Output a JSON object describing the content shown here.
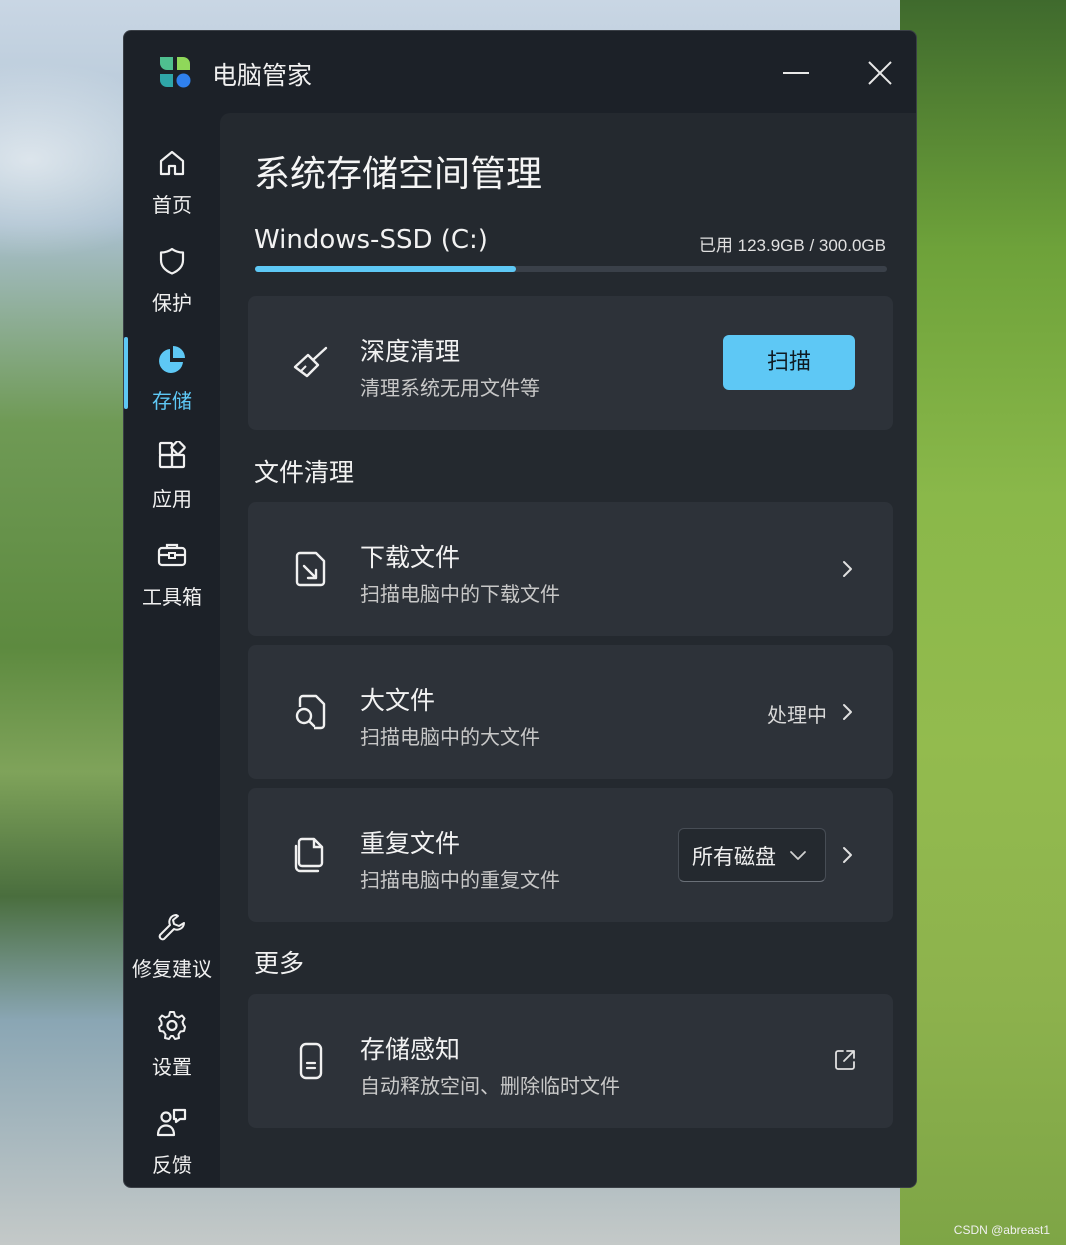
{
  "app": {
    "title": "电脑管家"
  },
  "sidebar": {
    "items": [
      {
        "label": "首页",
        "icon": "home-icon"
      },
      {
        "label": "保护",
        "icon": "shield-icon"
      },
      {
        "label": "存储",
        "icon": "pie-chart-icon",
        "active": true
      },
      {
        "label": "应用",
        "icon": "apps-icon"
      },
      {
        "label": "工具箱",
        "icon": "toolbox-icon"
      }
    ],
    "bottom_items": [
      {
        "label": "修复建议",
        "icon": "wrench-icon"
      },
      {
        "label": "设置",
        "icon": "gear-icon"
      },
      {
        "label": "反馈",
        "icon": "feedback-icon"
      }
    ]
  },
  "page": {
    "title": "系统存储空间管理"
  },
  "drive": {
    "name": "Windows-SSD (C:)",
    "usage_text": "已用 123.9GB / 300.0GB",
    "used_gb": 123.9,
    "total_gb": 300.0
  },
  "deep_clean": {
    "title": "深度清理",
    "subtitle": "清理系统无用文件等",
    "button_label": "扫描",
    "icon": "broom-icon"
  },
  "file_cleanup": {
    "section_title": "文件清理",
    "downloads": {
      "title": "下载文件",
      "subtitle": "扫描电脑中的下载文件",
      "icon": "download-file-icon"
    },
    "large_files": {
      "title": "大文件",
      "subtitle": "扫描电脑中的大文件",
      "status": "处理中",
      "icon": "file-search-icon"
    },
    "duplicates": {
      "title": "重复文件",
      "subtitle": "扫描电脑中的重复文件",
      "dropdown_value": "所有磁盘",
      "icon": "duplicate-file-icon"
    }
  },
  "more": {
    "section_title": "更多",
    "storage_sense": {
      "title": "存储感知",
      "subtitle": "自动释放空间、删除临时文件",
      "icon": "phone-storage-icon"
    }
  },
  "watermark": "CSDN @abreast1",
  "colors": {
    "accent": "#5ec8f5",
    "window_bg": "#1c2128",
    "content_bg": "#24292f",
    "card_bg": "#2d3239"
  }
}
